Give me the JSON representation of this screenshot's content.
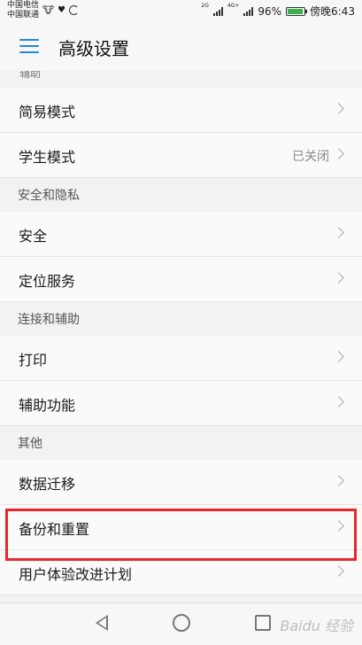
{
  "status_bar": {
    "carrier_1": "中国电信",
    "carrier_2": "中国联通",
    "net_1": "2G",
    "net_2": "4G+",
    "battery": "96%",
    "time": "傍晚6:43",
    "battery_color": "#3cb04a"
  },
  "app_bar": {
    "title": "高级设置",
    "menu_icon": "hamburger-menu-icon",
    "accent": "#1e88e5"
  },
  "list": {
    "partial_header": "辅助",
    "items_top": [
      {
        "label": "简易模式",
        "value": ""
      },
      {
        "label": "学生模式",
        "value": "已关闭"
      }
    ],
    "sections": [
      {
        "header": "安全和隐私",
        "items": [
          {
            "label": "安全"
          },
          {
            "label": "定位服务"
          }
        ]
      },
      {
        "header": "连接和辅助",
        "items": [
          {
            "label": "打印"
          },
          {
            "label": "辅助功能"
          }
        ]
      },
      {
        "header": "其他",
        "items": [
          {
            "label": "数据迁移"
          },
          {
            "label": "备份和重置"
          },
          {
            "label": "用户体验改进计划"
          }
        ]
      }
    ]
  },
  "highlight_color": "#e8262b",
  "watermark": "Baidu 经验"
}
